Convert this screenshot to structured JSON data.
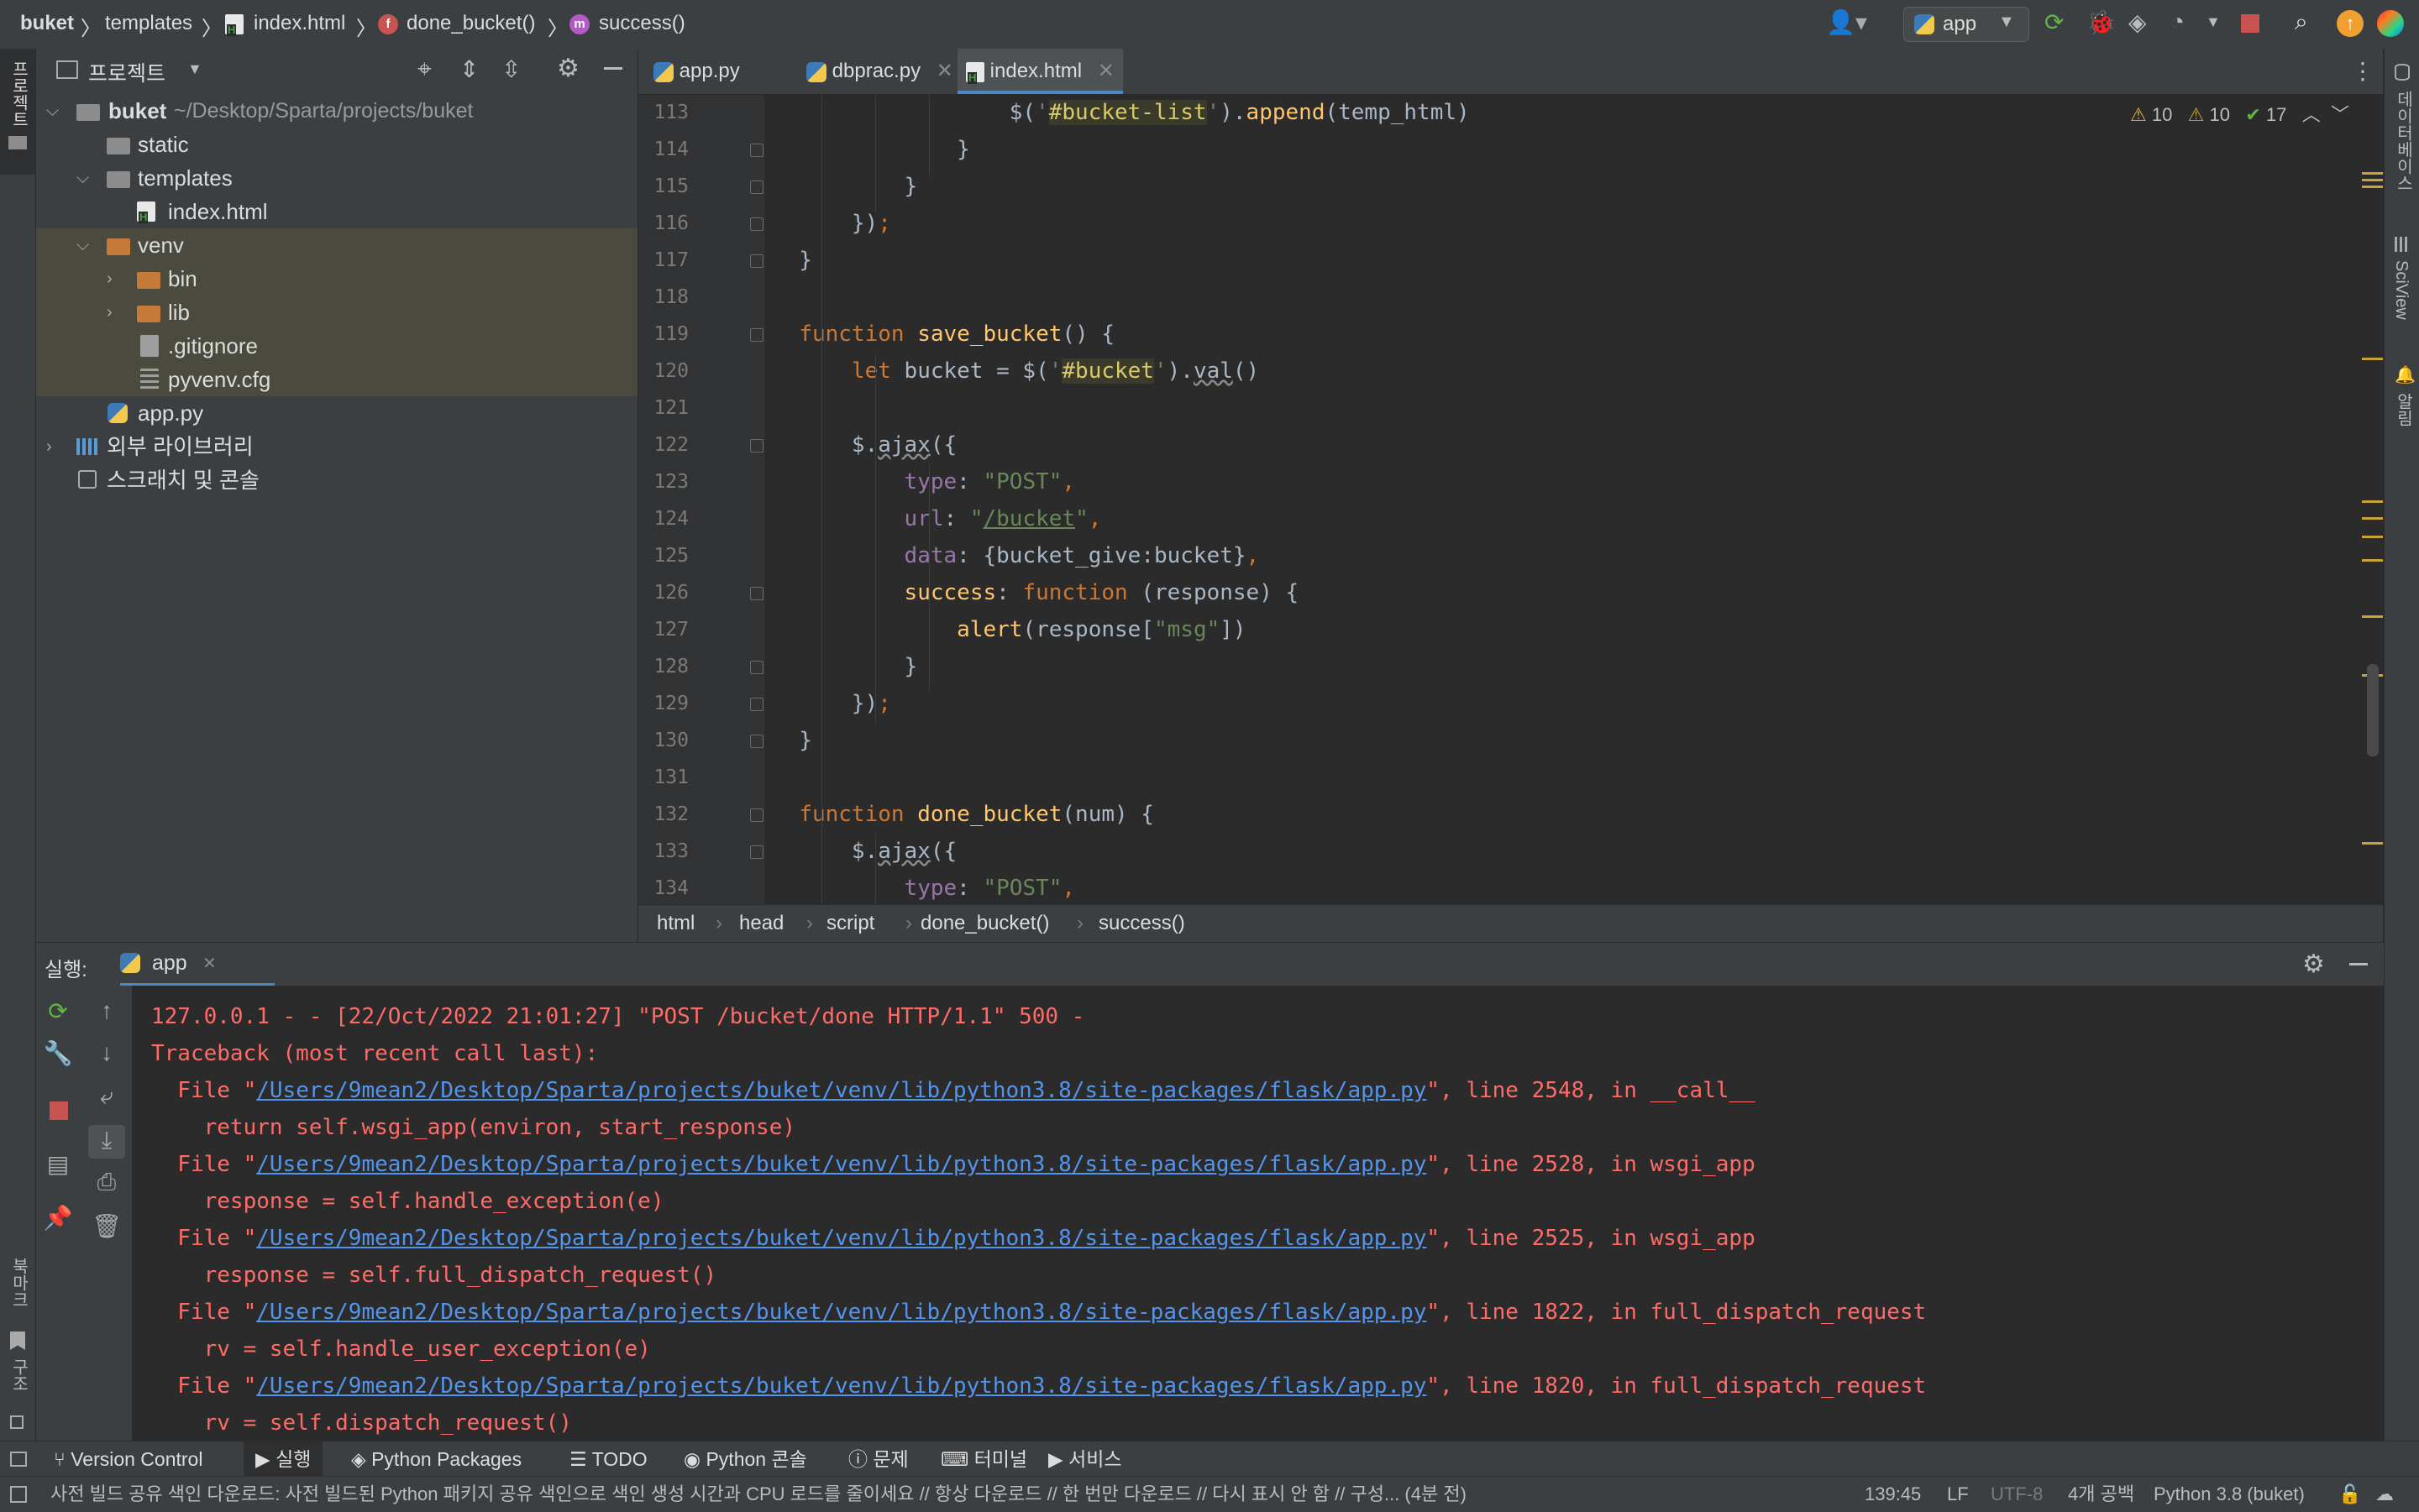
{
  "breadcrumb": {
    "project": "buket",
    "folder": "templates",
    "file": "index.html",
    "function": "done_bucket()",
    "method": "success()"
  },
  "toolbar": {
    "run_config": "app"
  },
  "project_panel": {
    "title": "프로젝트",
    "root_name": "buket",
    "root_path": "~/Desktop/Sparta/projects/buket",
    "items": [
      {
        "label": "static"
      },
      {
        "label": "templates"
      },
      {
        "label": "index.html"
      },
      {
        "label": "venv"
      },
      {
        "label": "bin"
      },
      {
        "label": "lib"
      },
      {
        "label": ".gitignore"
      },
      {
        "label": "pyvenv.cfg"
      },
      {
        "label": "app.py"
      },
      {
        "label": "외부 라이브러리"
      },
      {
        "label": "스크래치 및 콘솔"
      }
    ]
  },
  "tabs": [
    {
      "label": "app.py"
    },
    {
      "label": "dbprac.py"
    },
    {
      "label": "index.html"
    }
  ],
  "inspections": {
    "warnings_a": "10",
    "warnings_b": "10",
    "ok": "17"
  },
  "editor": {
    "line_numbers": [
      "113",
      "114",
      "115",
      "116",
      "117",
      "118",
      "119",
      "120",
      "121",
      "122",
      "123",
      "124",
      "125",
      "126",
      "127",
      "128",
      "129",
      "130",
      "131",
      "132",
      "133",
      "134"
    ]
  },
  "editor_breadcrumb": [
    "html",
    "head",
    "script",
    "done_bucket()",
    "success()"
  ],
  "run_panel": {
    "title": "실행:",
    "tab": "app",
    "lines": [
      "127.0.0.1 - - [22/Oct/2022 21:01:27] \"POST /bucket/done HTTP/1.1\" 500 -",
      "Traceback (most recent call last):",
      "  File \"",
      "/Users/9mean2/Desktop/Sparta/projects/buket/venv/lib/python3.8/site-packages/flask/app.py",
      "\", line 2548, in __call__",
      "    return self.wsgi_app(environ, start_response)",
      "\", line 2528, in wsgi_app",
      "    response = self.handle_exception(e)",
      "\", line 2525, in wsgi_app",
      "    response = self.full_dispatch_request()",
      "\", line 1822, in full_dispatch_request",
      "    rv = self.handle_user_exception(e)",
      "\", line 1820, in full_dispatch_request",
      "    rv = self.dispatch_request()"
    ]
  },
  "tool_tabs": [
    "Version Control",
    "실행",
    "Python Packages",
    "TODO",
    "Python 콘솔",
    "문제",
    "터미널",
    "서비스"
  ],
  "right_strip": [
    "데이터베이스",
    "SciView",
    "알림"
  ],
  "left_strip": [
    "프로젝트",
    "북마크",
    "구조"
  ],
  "status_bar": {
    "message": "사전 빌드 공유 색인 다운로드: 사전 빌드된 Python 패키지 공유 색인으로 색인 생성 시간과 CPU 로드를 줄이세요 // 항상 다운로드 // 한 번만 다운로드 // 다시 표시 안 함 // 구성... (4분 전)",
    "position": "139:45",
    "line_sep": "LF",
    "encoding": "UTF-8",
    "indent": "4개 공백",
    "interpreter": "Python 3.8 (buket)"
  }
}
